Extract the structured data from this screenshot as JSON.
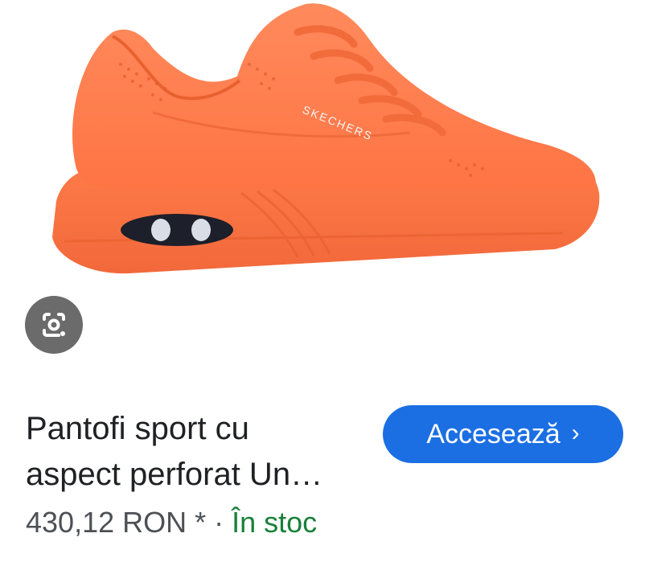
{
  "product": {
    "image_alt": "Orange Skechers sneaker",
    "brand_print": "SKECHERS",
    "title_line1": "Pantofi sport cu",
    "title_line2": "aspect perforat Un…",
    "price": "430,12 RON",
    "price_marker": " * ",
    "separator": "· ",
    "availability": "În stoc"
  },
  "actions": {
    "visit_label": "Accesează",
    "visit_chevron": "›",
    "lens_icon": "google-lens-icon"
  },
  "colors": {
    "shoe": "#ff7d4c",
    "button": "#1b6fe3",
    "in_stock": "#188038",
    "lens_bg": "#6b6b6b"
  }
}
